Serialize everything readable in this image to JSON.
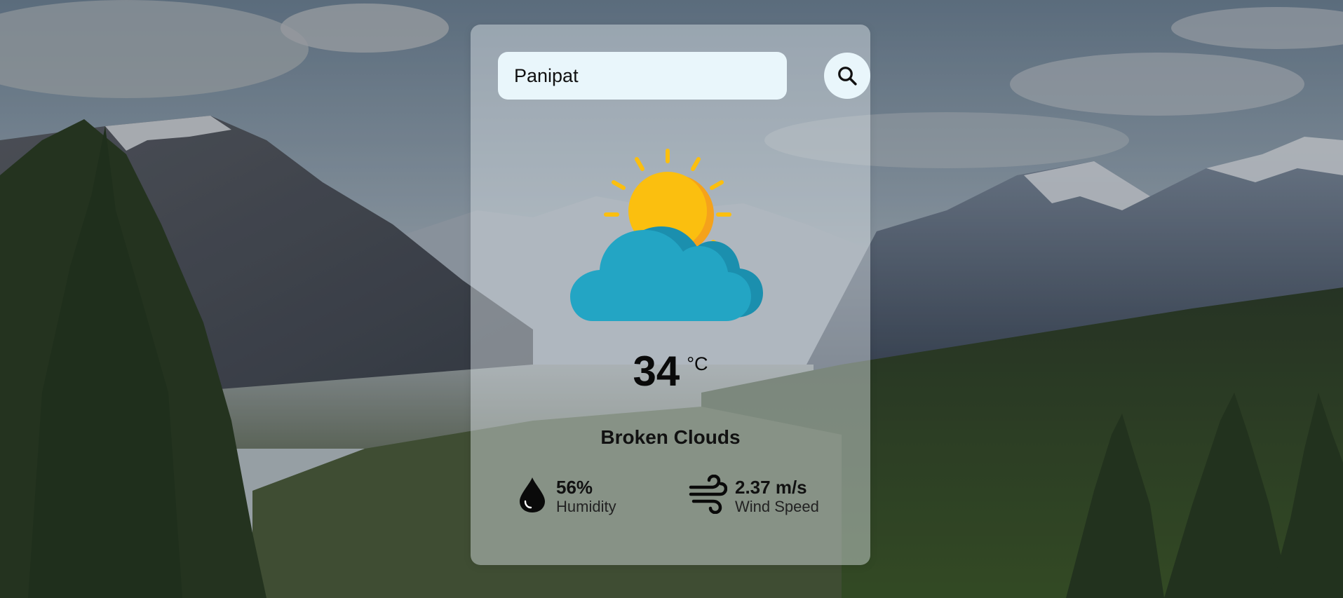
{
  "search": {
    "value": "Panipat"
  },
  "weather": {
    "icon": "partly-cloudy-sun-icon",
    "temperature": "34",
    "unit": "°C",
    "condition": "Broken Clouds"
  },
  "stats": {
    "humidity": {
      "value": "56%",
      "label": "Humidity",
      "icon": "water-drop-icon"
    },
    "wind": {
      "value": "2.37 m/s",
      "label": "Wind Speed",
      "icon": "wind-icon"
    }
  },
  "colors": {
    "input_bg": "#e9f6fb",
    "sun": "#fbbf0f",
    "sun_shade": "#f5a21b",
    "cloud": "#23a5c4",
    "cloud_shade": "#1b8fae",
    "text": "#111111"
  }
}
